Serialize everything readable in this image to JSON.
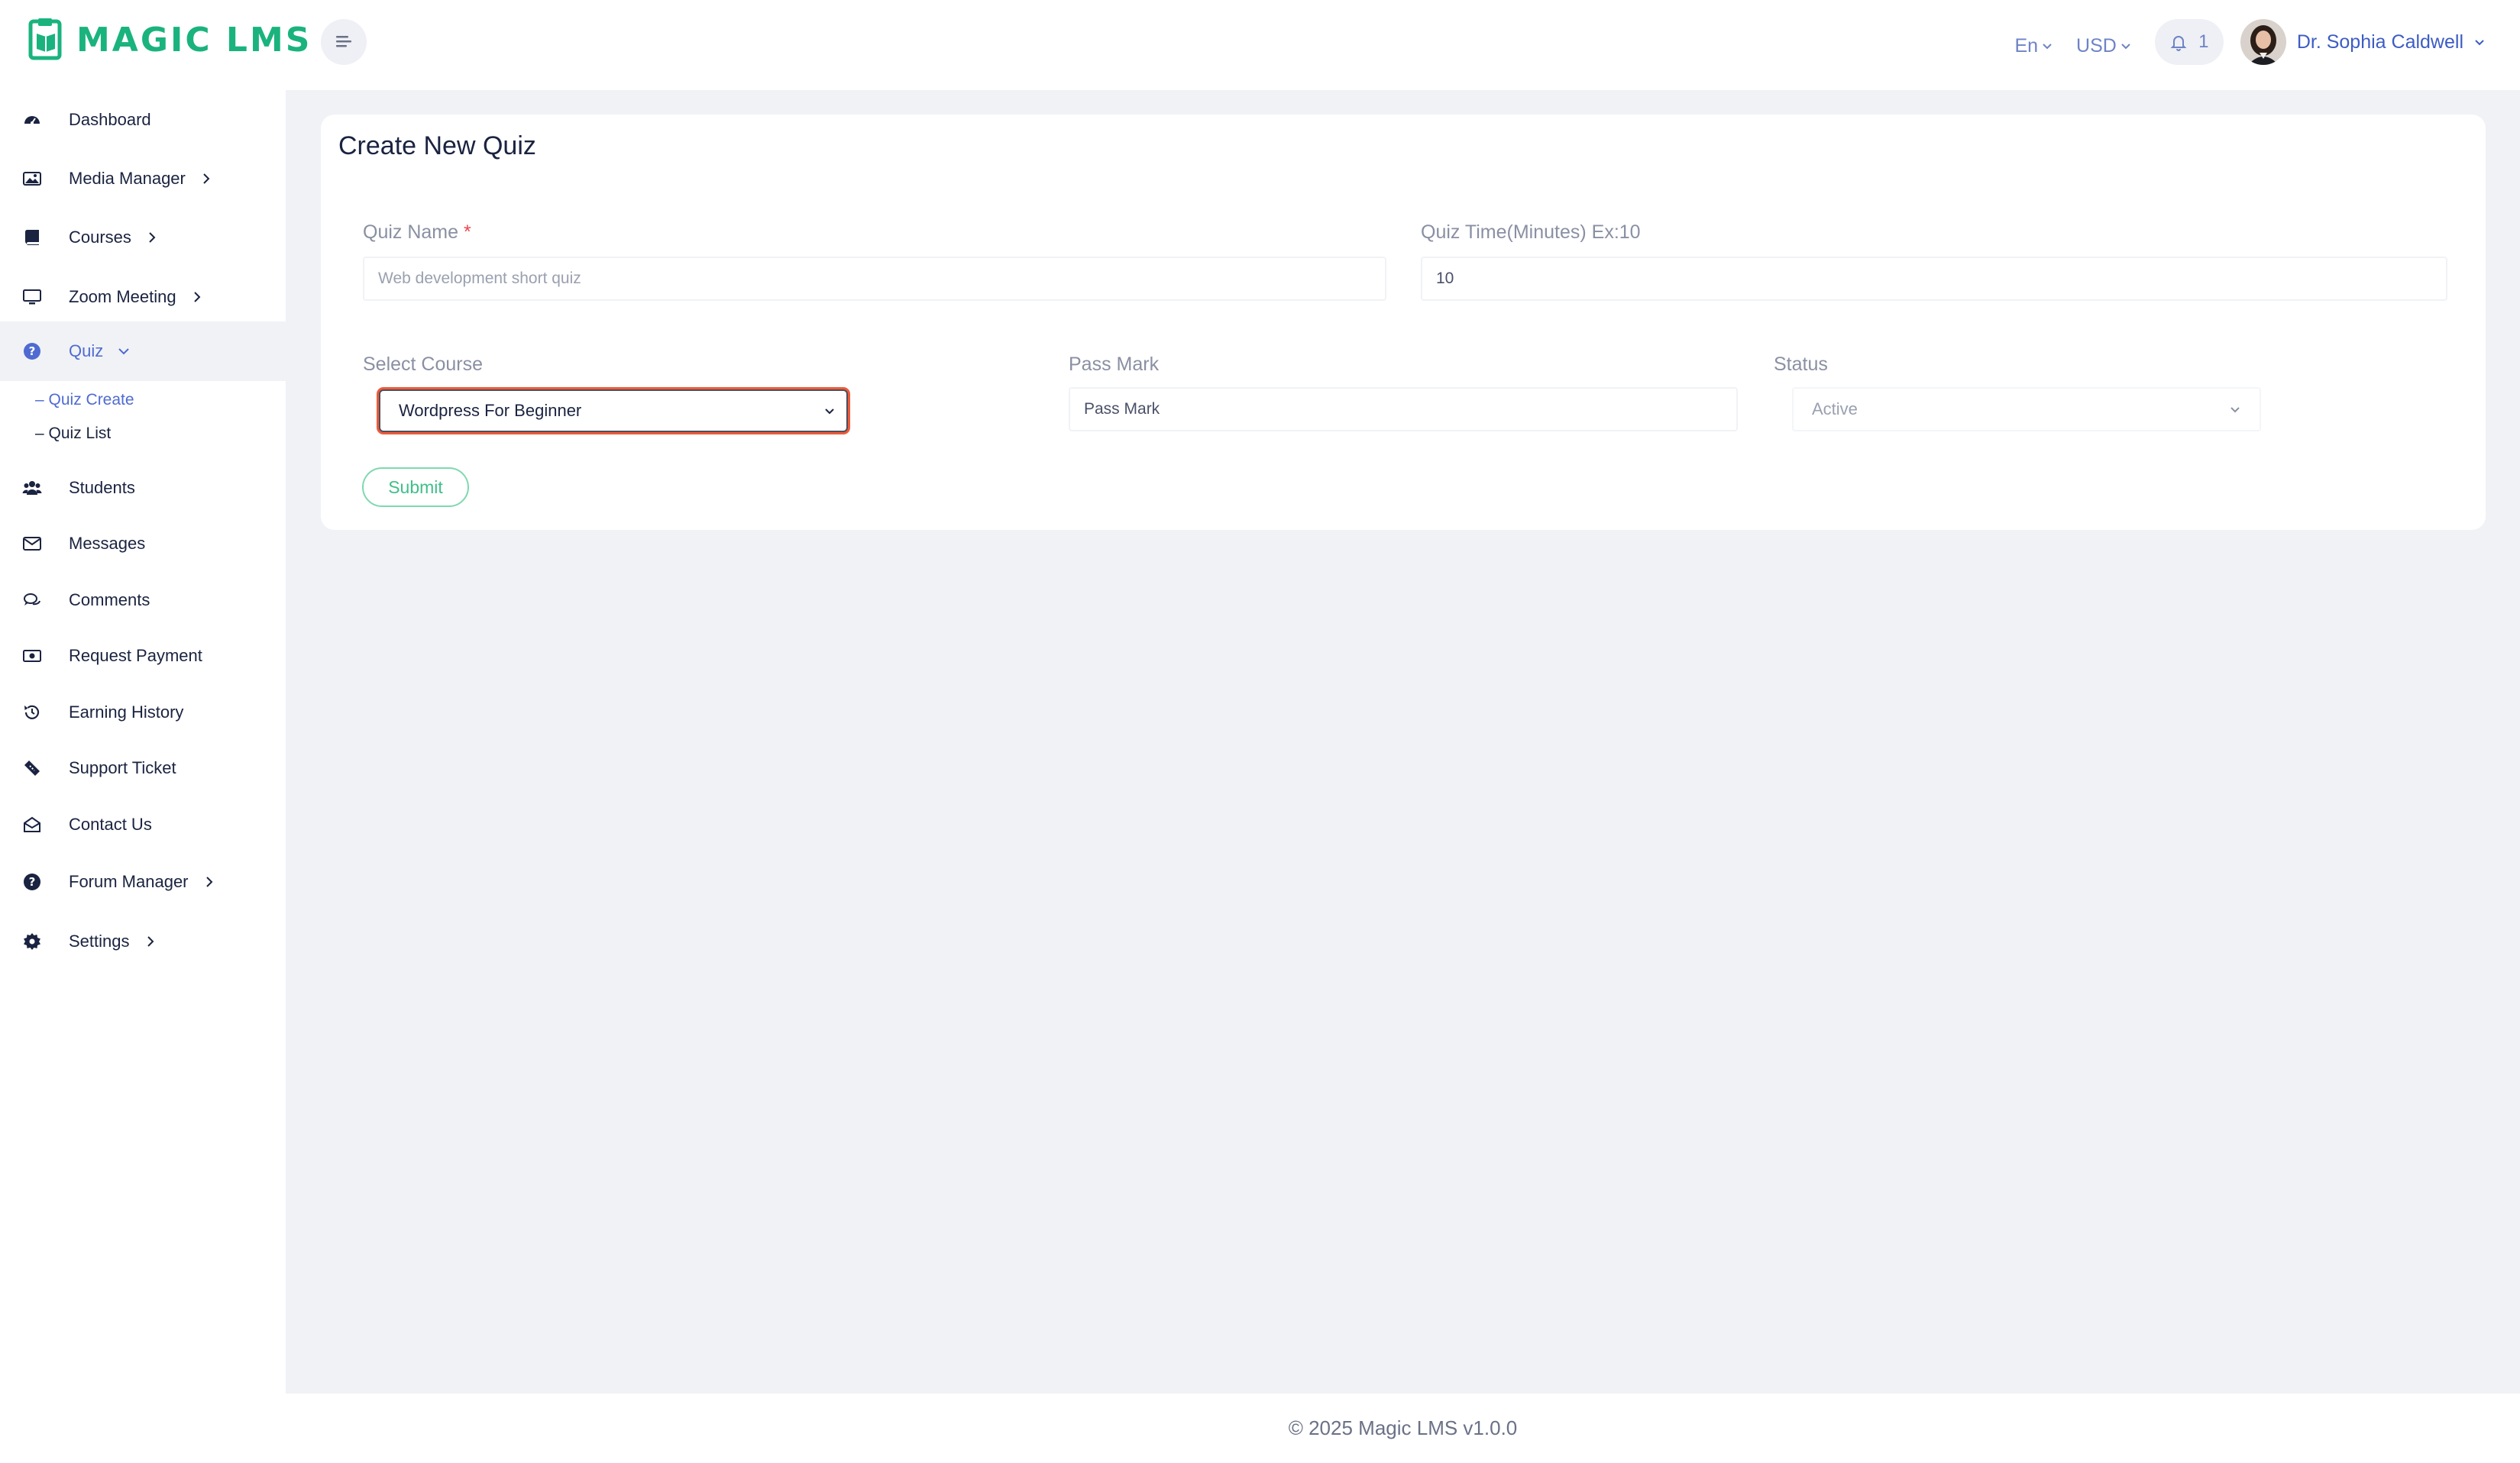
{
  "brand": {
    "name": "MAGIC LMS",
    "accent": "#1ab37e"
  },
  "header": {
    "language": "En",
    "currency": "USD",
    "notification_count": "1",
    "user_name": "Dr. Sophia Caldwell"
  },
  "sidebar": {
    "items": [
      {
        "label": "Dashboard",
        "icon": "dashboard-icon"
      },
      {
        "label": "Media Manager",
        "icon": "image-icon",
        "expandable": true
      },
      {
        "label": "Courses",
        "icon": "book-icon",
        "expandable": true
      },
      {
        "label": "Zoom Meeting",
        "icon": "monitor-icon",
        "expandable": true
      },
      {
        "label": "Quiz",
        "icon": "question-icon",
        "expandable": true,
        "expanded": true,
        "active": true
      },
      {
        "label": "Students",
        "icon": "users-icon"
      },
      {
        "label": "Messages",
        "icon": "envelope-icon"
      },
      {
        "label": "Comments",
        "icon": "comments-icon"
      },
      {
        "label": "Request Payment",
        "icon": "money-icon"
      },
      {
        "label": "Earning History",
        "icon": "history-icon"
      },
      {
        "label": "Support Ticket",
        "icon": "ticket-icon"
      },
      {
        "label": "Contact Us",
        "icon": "envelope-open-icon"
      },
      {
        "label": "Forum Manager",
        "icon": "question-icon",
        "expandable": true
      },
      {
        "label": "Settings",
        "icon": "gear-icon",
        "expandable": true
      }
    ],
    "quiz_subitems": [
      {
        "label": "– Quiz Create",
        "active": true
      },
      {
        "label": "– Quiz List"
      }
    ]
  },
  "form": {
    "title": "Create New Quiz",
    "quiz_name_label": "Quiz Name",
    "required_mark": "*",
    "quiz_name_placeholder": "Web development short quiz",
    "quiz_time_label": "Quiz Time(Minutes) Ex:10",
    "quiz_time_value": "10",
    "select_course_label": "Select Course",
    "select_course_value": "Wordpress For Beginner",
    "pass_mark_label": "Pass Mark",
    "pass_mark_placeholder": "Pass Mark",
    "status_label": "Status",
    "status_value": "Active",
    "submit_label": "Submit"
  },
  "footer": {
    "text": "© 2025 Magic LMS v1.0.0"
  }
}
